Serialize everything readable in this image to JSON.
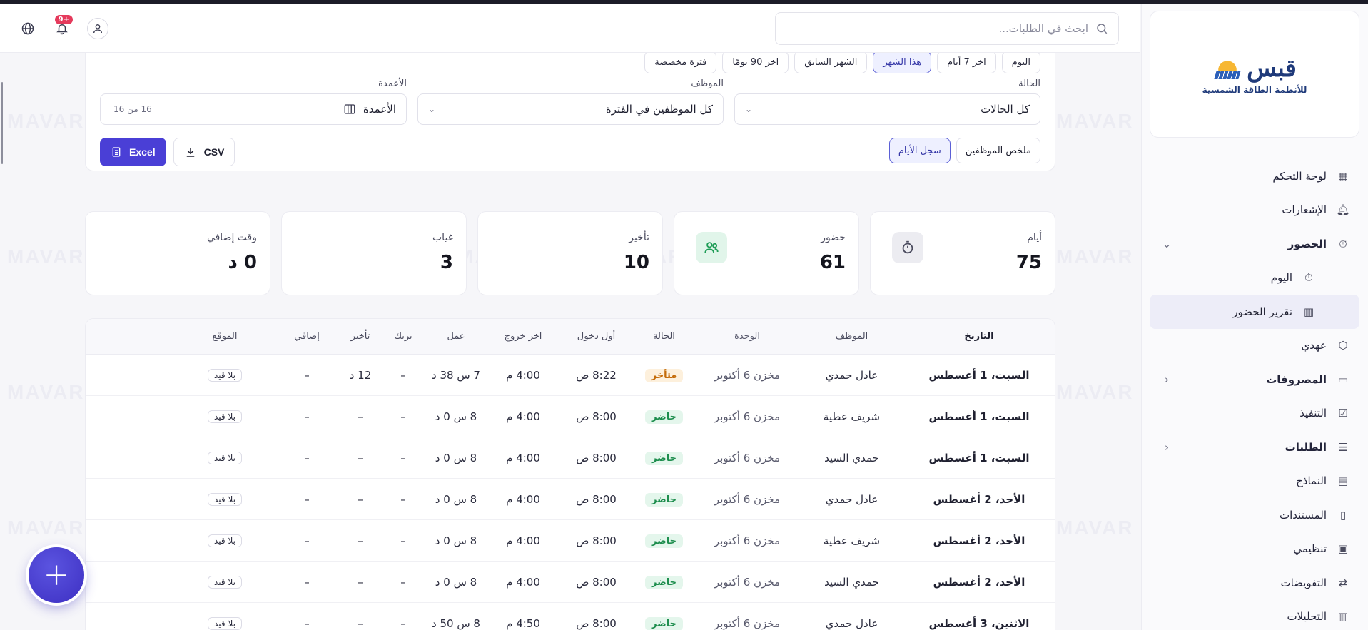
{
  "brand": {
    "title": "قبس",
    "subtitle": "للأنظمة الطاقة الشمسية"
  },
  "sidebar": {
    "items": [
      {
        "label": "لوحة التحكم",
        "icon": "dashboard-icon"
      },
      {
        "label": "الإشعارات",
        "icon": "bell-icon"
      },
      {
        "label": "الحضور",
        "icon": "stopwatch-icon",
        "expanded": true
      },
      {
        "label": "اليوم",
        "icon": "stopwatch-icon"
      },
      {
        "label": "تقرير الحضور",
        "icon": "bar-chart-icon",
        "active": true
      },
      {
        "label": "عهدي",
        "icon": "box-icon"
      },
      {
        "label": "المصروفات",
        "icon": "wallet-icon",
        "collapsed": true
      },
      {
        "label": "التنفيذ",
        "icon": "clipboard-check-icon"
      },
      {
        "label": "الطلبات",
        "icon": "checklist-icon",
        "collapsed": true
      },
      {
        "label": "النماذج",
        "icon": "clipboard-icon"
      },
      {
        "label": "المستندات",
        "icon": "document-icon"
      },
      {
        "label": "تنظيمي",
        "icon": "briefcase-icon"
      },
      {
        "label": "التفويضات",
        "icon": "swap-icon"
      },
      {
        "label": "التحليلات",
        "icon": "bar-chart-icon"
      }
    ]
  },
  "header": {
    "search_placeholder": "ابحث في الطلبات...",
    "notifications_badge": "+9"
  },
  "filters": {
    "periods": [
      "اليوم",
      "اخر 7 أيام",
      "هذا الشهر",
      "الشهر السابق",
      "اخر 90 يومًا",
      "فترة مخصصة"
    ],
    "active_period": "هذا الشهر",
    "status_label": "الحالة",
    "status_value": "كل الحالات",
    "employee_label": "الموظف",
    "employee_value": "كل الموظفين في الفترة",
    "columns_label": "الأعمدة",
    "columns_value": "الأعمدة",
    "columns_count": "16 من 16",
    "view_tabs": [
      "ملخص الموظفين",
      "سجل الأيام"
    ],
    "active_view": "سجل الأيام",
    "csv_label": "CSV",
    "excel_label": "Excel"
  },
  "stats": [
    {
      "label": "أيام",
      "value": "75",
      "icon": "stopwatch-icon"
    },
    {
      "label": "حضور",
      "value": "61",
      "icon": "users-icon"
    },
    {
      "label": "تأخير",
      "value": "10"
    },
    {
      "label": "غياب",
      "value": "3"
    },
    {
      "label": "وقت إضافي",
      "value": "0 د"
    }
  ],
  "table": {
    "headers": [
      "التاريخ",
      "الموظف",
      "الوحدة",
      "الحالة",
      "أول دخول",
      "اخر خروج",
      "عمل",
      "بريك",
      "تأخير",
      "إضافي",
      "الموقع"
    ],
    "rows": [
      {
        "date": "السبت، 1 أغسطس",
        "employee": "عادل حمدي",
        "unit": "مخزن 6 أكتوبر",
        "status": "متأخر",
        "status_kind": "late",
        "in": "8:22 ص",
        "out": "4:00 م",
        "work": "7 س 38 د",
        "break": "–",
        "late": "12 د",
        "extra": "–",
        "location": "بلا قيد"
      },
      {
        "date": "السبت، 1 أغسطس",
        "employee": "شريف عطية",
        "unit": "مخزن 6 أكتوبر",
        "status": "حاضر",
        "status_kind": "present",
        "in": "8:00 ص",
        "out": "4:00 م",
        "work": "8 س 0 د",
        "break": "–",
        "late": "–",
        "extra": "–",
        "location": "بلا قيد"
      },
      {
        "date": "السبت، 1 أغسطس",
        "employee": "حمدي السيد",
        "unit": "مخزن 6 أكتوبر",
        "status": "حاضر",
        "status_kind": "present",
        "in": "8:00 ص",
        "out": "4:00 م",
        "work": "8 س 0 د",
        "break": "–",
        "late": "–",
        "extra": "–",
        "location": "بلا قيد"
      },
      {
        "date": "الأحد، 2 أغسطس",
        "employee": "عادل حمدي",
        "unit": "مخزن 6 أكتوبر",
        "status": "حاضر",
        "status_kind": "present",
        "in": "8:00 ص",
        "out": "4:00 م",
        "work": "8 س 0 د",
        "break": "–",
        "late": "–",
        "extra": "–",
        "location": "بلا قيد"
      },
      {
        "date": "الأحد، 2 أغسطس",
        "employee": "شريف عطية",
        "unit": "مخزن 6 أكتوبر",
        "status": "حاضر",
        "status_kind": "present",
        "in": "8:00 ص",
        "out": "4:00 م",
        "work": "8 س 0 د",
        "break": "–",
        "late": "–",
        "extra": "–",
        "location": "بلا قيد"
      },
      {
        "date": "الأحد، 2 أغسطس",
        "employee": "حمدي السيد",
        "unit": "مخزن 6 أكتوبر",
        "status": "حاضر",
        "status_kind": "present",
        "in": "8:00 ص",
        "out": "4:00 م",
        "work": "8 س 0 د",
        "break": "–",
        "late": "–",
        "extra": "–",
        "location": "بلا قيد"
      },
      {
        "date": "الاثنين، 3 أغسطس",
        "employee": "عادل حمدي",
        "unit": "مخزن 6 أكتوبر",
        "status": "حاضر",
        "status_kind": "present",
        "in": "8:00 ص",
        "out": "4:50 م",
        "work": "8 س 50 د",
        "break": "–",
        "late": "–",
        "extra": "–",
        "location": "بلا قيد"
      }
    ]
  },
  "watermark_text": "MAVAR",
  "colors": {
    "accent": "#4a3fd6",
    "late": "#c46b08",
    "present": "#1e8e4e",
    "badge": "#e53a5c"
  }
}
